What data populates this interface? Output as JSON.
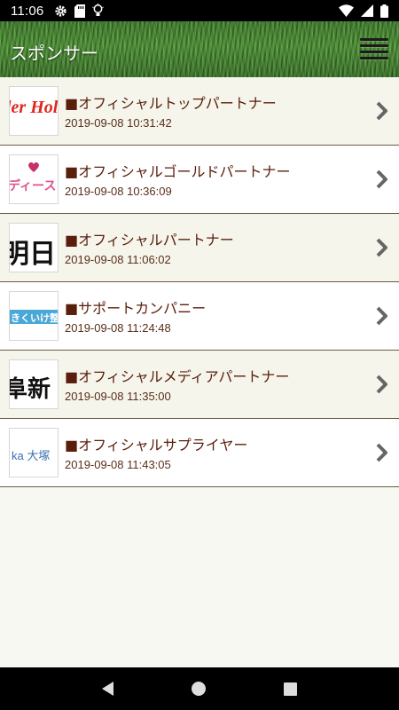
{
  "status_bar": {
    "time": "11:06",
    "left_icons": [
      "gear-icon",
      "sd-card-icon",
      "lightbulb-icon"
    ],
    "right_icons": [
      "wifi-icon",
      "signal-icon",
      "battery-icon"
    ]
  },
  "header": {
    "title": "スポンサー",
    "menu_icon": "hamburger-menu-icon"
  },
  "sponsors": [
    {
      "title": "■オフィシャルトップパートナー",
      "date": "2019-09-08 10:31:42",
      "thumb_text": "ler Hol"
    },
    {
      "title": "■オフィシャルゴールドパートナー",
      "date": "2019-09-08 10:36:09",
      "thumb_text": "ディース"
    },
    {
      "title": "■オフィシャルパートナー",
      "date": "2019-09-08 11:06:02",
      "thumb_text": "明日ナ"
    },
    {
      "title": "■サポートカンパニー",
      "date": "2019-09-08 11:24:48",
      "thumb_text": "きくいけ整形"
    },
    {
      "title": "■オフィシャルメディアパートナー",
      "date": "2019-09-08 11:35:00",
      "thumb_text": "阜新"
    },
    {
      "title": "■オフィシャルサプライヤー",
      "date": "2019-09-08 11:43:05",
      "thumb_text": "ka 大塚"
    }
  ],
  "colors": {
    "title_text": "#5a1e0c",
    "divider": "#6a5a45",
    "chevron": "#666666"
  },
  "nav_bar": {
    "icons": [
      "back-icon",
      "home-icon",
      "recents-icon"
    ]
  }
}
